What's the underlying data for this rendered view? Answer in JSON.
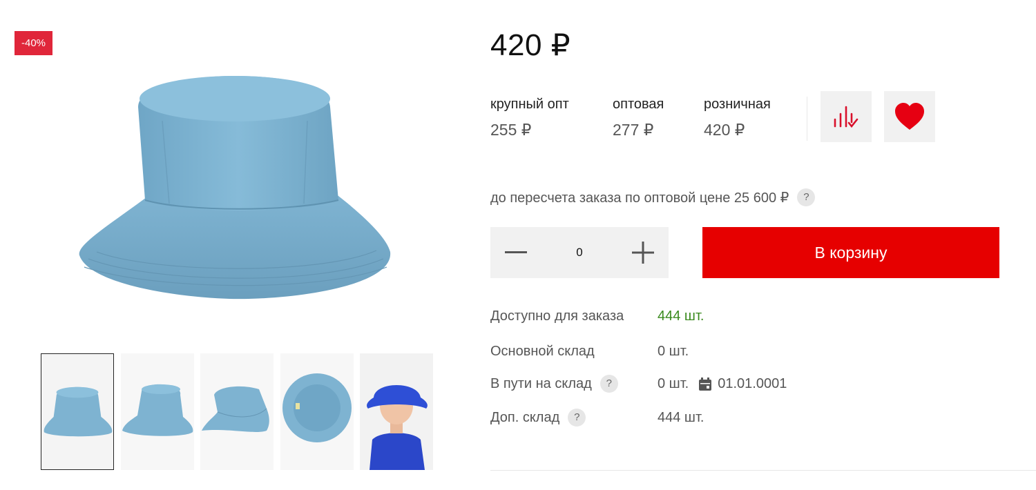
{
  "gallery": {
    "badge": "-40%",
    "main_image_alt": "Панама голубая",
    "thumbnails": [
      {
        "name": "thumb-front",
        "active": true
      },
      {
        "name": "thumb-angle",
        "active": false
      },
      {
        "name": "thumb-side",
        "active": false
      },
      {
        "name": "thumb-inside",
        "active": false
      },
      {
        "name": "thumb-model",
        "active": false
      }
    ]
  },
  "price": {
    "main": "420 ₽",
    "tiers": [
      {
        "label": "крупный опт",
        "value": "255 ₽"
      },
      {
        "label": "оптовая",
        "value": "277 ₽"
      },
      {
        "label": "розничная",
        "value": "420 ₽"
      }
    ]
  },
  "actions": {
    "compare_icon": "compare-icon",
    "favorite_icon": "heart-icon"
  },
  "recalc_note": "до пересчета заказа по оптовой цене 25 600 ₽",
  "help_glyph": "?",
  "quantity": {
    "value": "0",
    "minus_icon": "minus-icon",
    "plus_icon": "plus-icon"
  },
  "cart_button": "В корзину",
  "stock": {
    "available_label": "Доступно для заказа",
    "available_value": "444 шт.",
    "main_label": "Основной склад",
    "main_value": "0 шт.",
    "transit_label": "В пути на склад",
    "transit_value": "0 шт.",
    "transit_date": "01.01.0001",
    "extra_label": "Доп. склад",
    "extra_value": "444 шт."
  },
  "colors": {
    "accent": "#e60000",
    "badge": "#e0263a",
    "available": "#3a8a1e",
    "hat": "#7eb3d1",
    "icon_red": "#d9102b"
  }
}
